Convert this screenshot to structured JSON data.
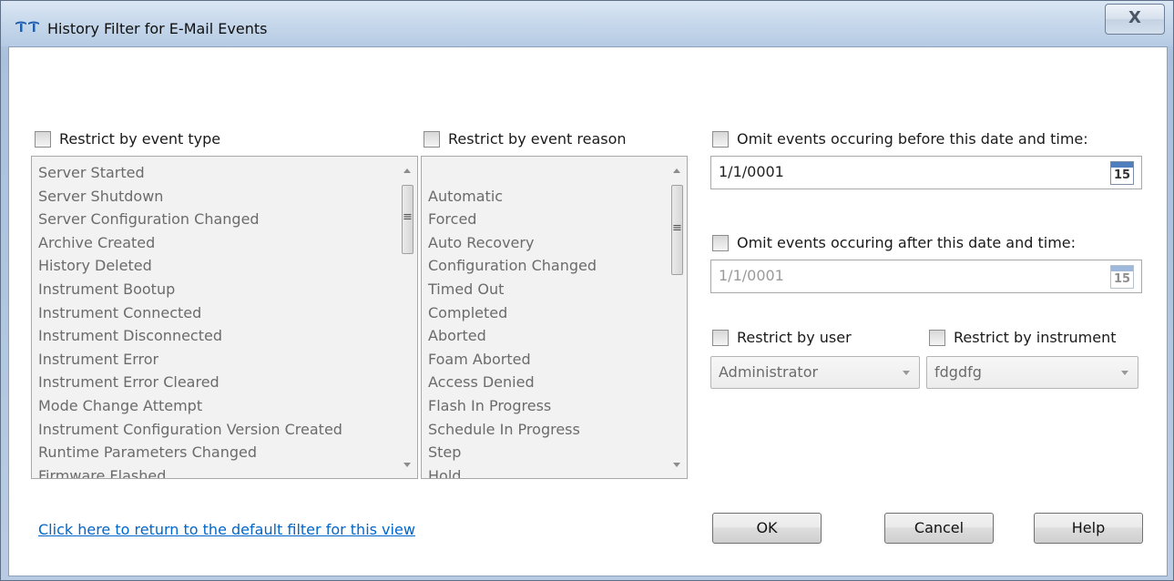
{
  "window": {
    "title": "History Filter for E-Mail Events",
    "close_glyph": "X"
  },
  "event_type": {
    "label": "Restrict by event type",
    "items": [
      "Server Started",
      "Server Shutdown",
      "Server Configuration Changed",
      "Archive Created",
      "History Deleted",
      "Instrument Bootup",
      "Instrument Connected",
      "Instrument Disconnected",
      "Instrument Error",
      "Instrument Error Cleared",
      "Mode Change Attempt",
      "Instrument Configuration Version Created",
      "Runtime Parameters Changed",
      "Firmware Flashed"
    ]
  },
  "event_reason": {
    "label": "Restrict by event reason",
    "items": [
      "",
      "Automatic",
      "Forced",
      "Auto Recovery",
      "Configuration Changed",
      "Timed Out",
      "Completed",
      "Aborted",
      "Foam Aborted",
      "Access Denied",
      "Flash In Progress",
      "Schedule In Progress",
      "Step",
      "Hold"
    ]
  },
  "omit_before": {
    "label": "Omit events occuring before this date and time:",
    "value": "1/1/0001",
    "calendar_day": "15"
  },
  "omit_after": {
    "label": "Omit events occuring after this date and time:",
    "value": "1/1/0001",
    "calendar_day": "15"
  },
  "user": {
    "label": "Restrict by user",
    "value": "Administrator"
  },
  "instrument": {
    "label": "Restrict by instrument",
    "value": "fdgdfg"
  },
  "default_filter_link": "Click here to return to the default filter for this view",
  "buttons": {
    "ok": "OK",
    "cancel": "Cancel",
    "help": "Help"
  },
  "scroll_thumb_glyph": "≡",
  "colors": {
    "link": "#0066cc",
    "list_background": "#f2f2f2",
    "disabled_text": "#6b6b6b"
  }
}
